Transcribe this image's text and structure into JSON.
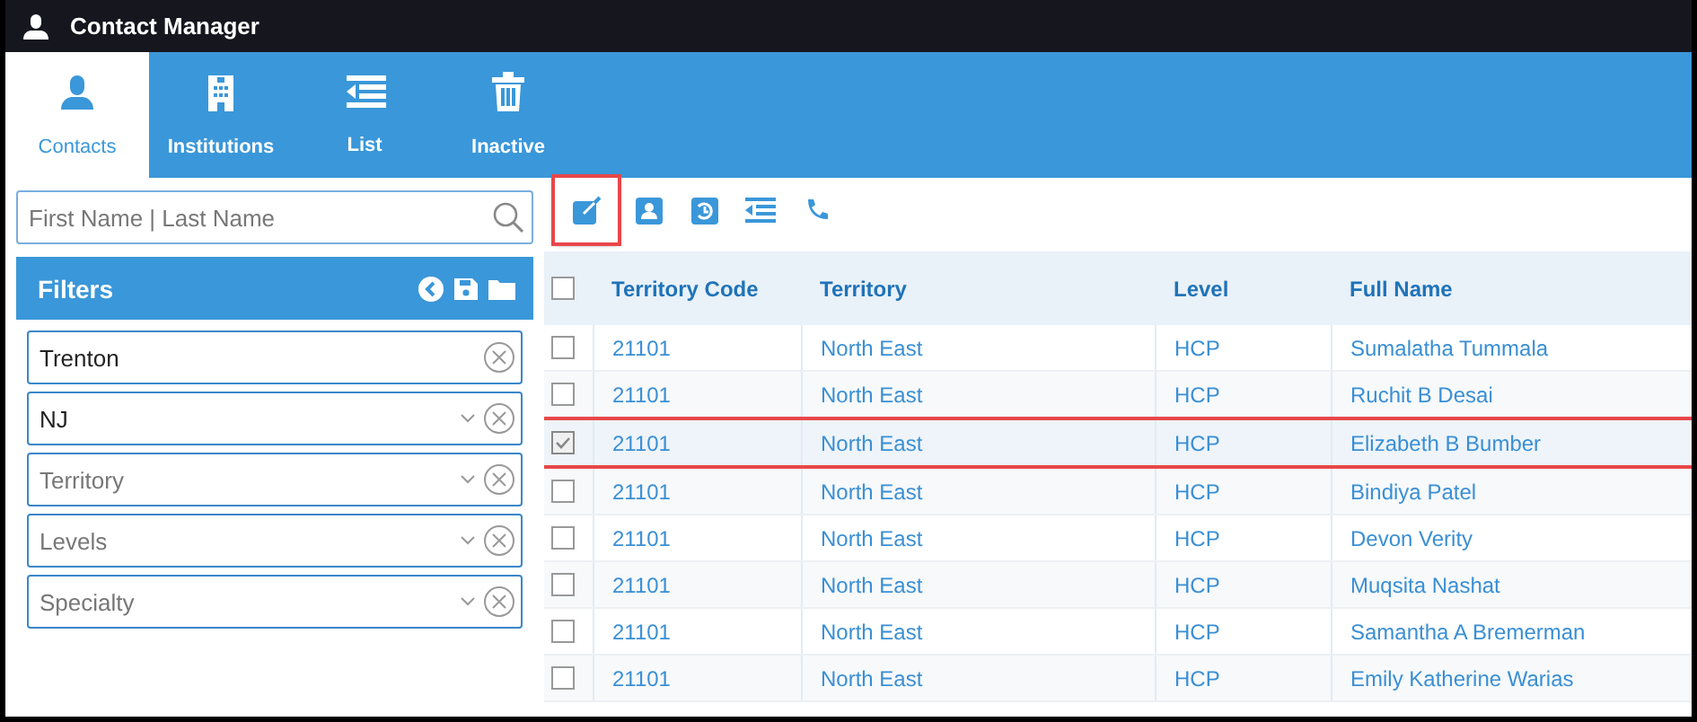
{
  "window": {
    "title": "Contact Manager"
  },
  "tabs": [
    {
      "label": "Contacts",
      "selected": true
    },
    {
      "label": "Institutions",
      "selected": false
    },
    {
      "label": "List",
      "selected": false
    },
    {
      "label": "Inactive",
      "selected": false
    }
  ],
  "search": {
    "placeholder": "First Name | Last Name"
  },
  "filters": {
    "title": "Filters",
    "fields": [
      {
        "kind": "text",
        "value": "Trenton"
      },
      {
        "kind": "select",
        "value": "NJ"
      },
      {
        "kind": "select",
        "placeholder": "Territory"
      },
      {
        "kind": "select",
        "placeholder": "Levels"
      },
      {
        "kind": "select",
        "placeholder": "Specialty"
      }
    ]
  },
  "toolbar": [
    {
      "highlighted": true
    },
    {
      "highlighted": false
    },
    {
      "highlighted": false
    },
    {
      "highlighted": false
    },
    {
      "highlighted": false
    }
  ],
  "table": {
    "all_checked": false,
    "columns": [
      "Territory Code",
      "Territory",
      "Level",
      "Full Name"
    ],
    "rows": [
      {
        "cells": [
          "21101",
          "North East",
          "HCP",
          "Sumalatha Tummala"
        ],
        "checked": false,
        "highlighted": false
      },
      {
        "cells": [
          "21101",
          "North East",
          "HCP",
          "Ruchit B Desai"
        ],
        "checked": false,
        "highlighted": false
      },
      {
        "cells": [
          "21101",
          "North East",
          "HCP",
          "Elizabeth B Bumber"
        ],
        "checked": true,
        "highlighted": true
      },
      {
        "cells": [
          "21101",
          "North East",
          "HCP",
          "Bindiya Patel"
        ],
        "checked": false,
        "highlighted": false
      },
      {
        "cells": [
          "21101",
          "North East",
          "HCP",
          "Devon Verity"
        ],
        "checked": false,
        "highlighted": false
      },
      {
        "cells": [
          "21101",
          "North East",
          "HCP",
          "Muqsita Nashat"
        ],
        "checked": false,
        "highlighted": false
      },
      {
        "cells": [
          "21101",
          "North East",
          "HCP",
          "Samantha A Bremerman"
        ],
        "checked": false,
        "highlighted": false
      },
      {
        "cells": [
          "21101",
          "North East",
          "HCP",
          "Emily Katherine Warias"
        ],
        "checked": false,
        "highlighted": false
      }
    ]
  }
}
